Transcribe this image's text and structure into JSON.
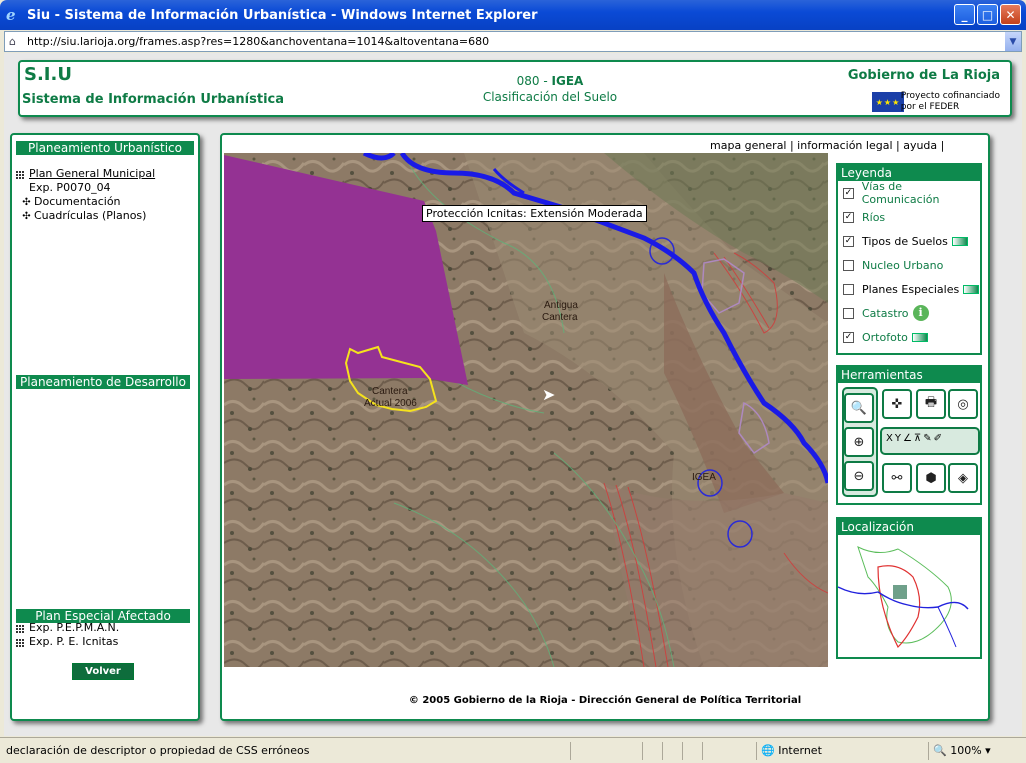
{
  "window": {
    "title": "Siu - Sistema de Información Urbanística - Windows Internet Explorer",
    "url": "http://siu.larioja.org/frames.asp?res=1280&anchoventana=1014&altoventana=680"
  },
  "header": {
    "acronym": "S.I.U",
    "app_name": "Sistema de Información Urbanística",
    "municipality_code": "080",
    "municipality_name": "IGEA",
    "view_name": "Clasificación del Suelo",
    "gov_logo": "Gobierno de La Rioja",
    "funding_line1": "Proyecto cofinanciado",
    "funding_line2": "por el FEDER"
  },
  "left_panel": {
    "planeamiento_urbanistico": {
      "title": "Planeamiento Urbanístico",
      "items": [
        {
          "label": "Plan General Municipal",
          "icon": "grid-icon",
          "link": true
        },
        {
          "label": "Exp. P0070_04",
          "icon": "none",
          "link": false
        },
        {
          "label": "Documentación",
          "icon": "expand-icon",
          "link": false
        },
        {
          "label": "Cuadrículas (Planos)",
          "icon": "expand-icon",
          "link": false
        }
      ]
    },
    "planeamiento_desarrollo": {
      "title": "Planeamiento de Desarrollo"
    },
    "plan_especial": {
      "title": "Plan Especial Afectado",
      "items": [
        {
          "label": "Exp. P.E.P.M.A.N.",
          "icon": "grid-icon"
        },
        {
          "label": "Exp. P. E. Icnitas",
          "icon": "grid-icon"
        }
      ]
    },
    "back_button": "Volver"
  },
  "top_links": "mapa general | información legal | ayuda | opciones | salir",
  "map": {
    "tooltip": "Protección Icnitas: Extensión Moderada",
    "labels": [
      "Antigua Cantera",
      "Cantera Actual 2006",
      "IGEA"
    ]
  },
  "legend": {
    "title": "Leyenda",
    "items": [
      {
        "label": "Vías de Comunicación",
        "checked": true,
        "color": "#0e7b45",
        "extra": "none"
      },
      {
        "label": "Ríos",
        "checked": true,
        "color": "#0e7b45",
        "extra": "none"
      },
      {
        "label": "Tipos de Suelos",
        "checked": true,
        "color": "#000000",
        "extra": "swatch"
      },
      {
        "label": "Nucleo Urbano",
        "checked": false,
        "color": "#0e7b45",
        "extra": "none"
      },
      {
        "label": "Planes Especiales",
        "checked": false,
        "color": "#000000",
        "extra": "swatch"
      },
      {
        "label": "Catastro",
        "checked": false,
        "color": "#0e7b45",
        "extra": "info"
      },
      {
        "label": "Ortofoto",
        "checked": true,
        "color": "#0e7b45",
        "extra": "swatch"
      }
    ]
  },
  "tools": {
    "title": "Herramientas"
  },
  "locator": {
    "title": "Localización"
  },
  "footer": "© 2005 Gobierno de la Rioja - Dirección General de Política Territorial",
  "status": {
    "message": "declaración de descriptor o propiedad de CSS erróneos",
    "zone": "Internet",
    "zoom": "100%"
  },
  "colors": {
    "brand": "#0e8a4e",
    "polygon": "#943293"
  }
}
